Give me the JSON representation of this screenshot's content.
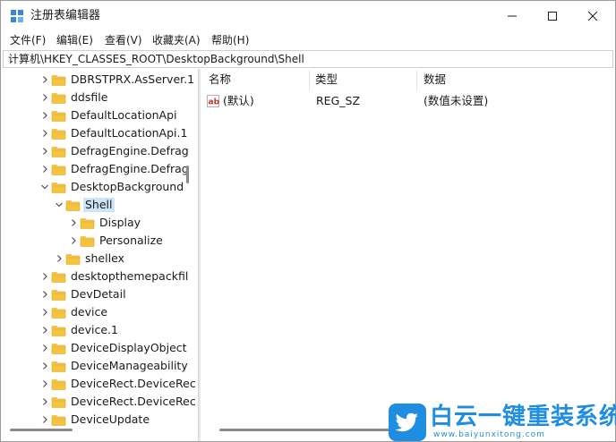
{
  "window": {
    "title": "注册表编辑器",
    "controls": {
      "minimize": "minimize-icon",
      "maximize": "maximize-icon",
      "close": "close-icon"
    }
  },
  "menu": {
    "items": [
      {
        "label": "文件(F)"
      },
      {
        "label": "编辑(E)"
      },
      {
        "label": "查看(V)"
      },
      {
        "label": "收藏夹(A)"
      },
      {
        "label": "帮助(H)"
      }
    ]
  },
  "address": {
    "path": "计算机\\HKEY_CLASSES_ROOT\\DesktopBackground\\Shell"
  },
  "tree": {
    "items": [
      {
        "label": "DBRSTPRX.AsServer.1",
        "expanded": false
      },
      {
        "label": "ddsfile",
        "expanded": false
      },
      {
        "label": "DefaultLocationApi",
        "expanded": false
      },
      {
        "label": "DefaultLocationApi.1",
        "expanded": false
      },
      {
        "label": "DefragEngine.Defrag",
        "expanded": false
      },
      {
        "label": "DefragEngine.Defrag",
        "expanded": false
      },
      {
        "label": "DesktopBackground",
        "expanded": true
      },
      {
        "label": "Shell",
        "expanded": true,
        "selected": true
      },
      {
        "label": "Display",
        "expanded": false
      },
      {
        "label": "Personalize",
        "expanded": false
      },
      {
        "label": "shellex",
        "expanded": false
      },
      {
        "label": "desktopthemepackfil",
        "expanded": false
      },
      {
        "label": "DevDetail",
        "expanded": false
      },
      {
        "label": "device",
        "expanded": false
      },
      {
        "label": "device.1",
        "expanded": false
      },
      {
        "label": "DeviceDisplayObject",
        "expanded": false
      },
      {
        "label": "DeviceManageability",
        "expanded": false
      },
      {
        "label": "DeviceRect.DeviceRec",
        "expanded": false
      },
      {
        "label": "DeviceRect.DeviceRec",
        "expanded": false
      },
      {
        "label": "DeviceUpdate",
        "expanded": false
      }
    ]
  },
  "list": {
    "columns": {
      "name": "名称",
      "type": "类型",
      "data": "数据"
    },
    "rows": [
      {
        "name": "(默认)",
        "type": "REG_SZ",
        "data": "(数值未设置)",
        "icon": "ab-string-icon"
      }
    ]
  },
  "watermark": {
    "text": "白云一键重装系统",
    "url": "www.baiyunxitong.com"
  },
  "colors": {
    "folder": "#f5c342",
    "selection": "#cce4f7",
    "watermark": "#1f8ee0"
  }
}
